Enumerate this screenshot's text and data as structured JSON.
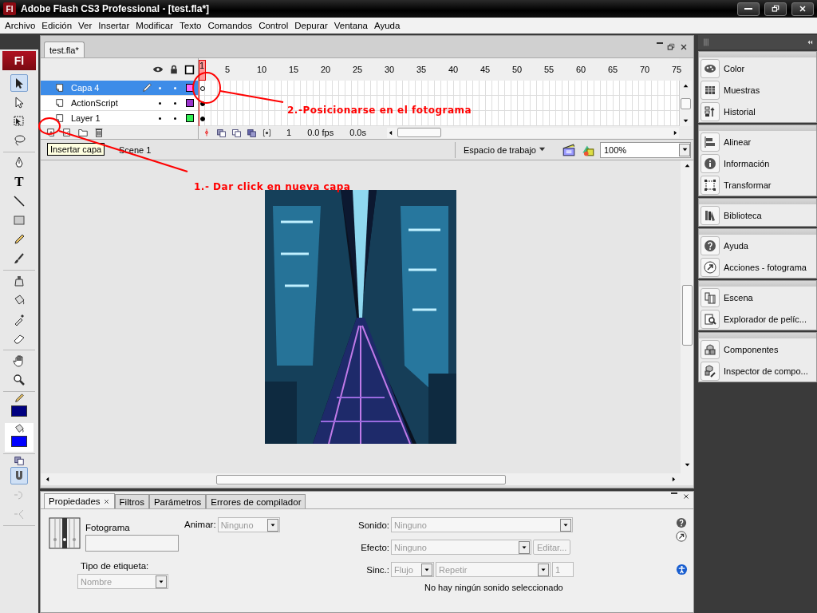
{
  "window": {
    "title": "Adobe Flash CS3 Professional - [test.fla*]",
    "badge": "Fl"
  },
  "menu": [
    "Archivo",
    "Edición",
    "Ver",
    "Insertar",
    "Modificar",
    "Texto",
    "Comandos",
    "Control",
    "Depurar",
    "Ventana",
    "Ayuda"
  ],
  "tools": {
    "logo": "Fl",
    "groups": [
      [
        {
          "kind": "selection",
          "selected": true
        },
        {
          "kind": "subselection",
          "selected": false
        },
        {
          "kind": "free-transform",
          "selected": false
        },
        {
          "kind": "lasso",
          "selected": false
        }
      ],
      [
        {
          "kind": "pen",
          "selected": false
        },
        {
          "kind": "text",
          "label": "T",
          "selected": false
        },
        {
          "kind": "line",
          "selected": false
        },
        {
          "kind": "rectangle",
          "selected": false
        },
        {
          "kind": "pencil",
          "selected": false
        },
        {
          "kind": "brush",
          "selected": false
        }
      ],
      [
        {
          "kind": "ink-bottle",
          "selected": false
        },
        {
          "kind": "paint-bucket",
          "selected": false
        },
        {
          "kind": "eyedropper",
          "selected": false
        },
        {
          "kind": "eraser",
          "selected": false
        }
      ],
      [
        {
          "kind": "hand",
          "selected": false
        },
        {
          "kind": "zoom",
          "selected": false
        }
      ]
    ],
    "stroke": {
      "color": "#000080"
    },
    "fill": {
      "color": "#0000ff"
    },
    "snap": {
      "on": true
    },
    "options": [
      {
        "kind": "smooth",
        "disabled": true
      },
      {
        "kind": "straighten",
        "disabled": true
      }
    ]
  },
  "document": {
    "tab": "test.fla*",
    "timeline": {
      "current_frame": "1",
      "frame_numbers": [
        "5",
        "10",
        "15",
        "20",
        "25",
        "30",
        "35",
        "40",
        "45",
        "50",
        "55",
        "60",
        "65",
        "70",
        "75"
      ],
      "layers": [
        {
          "name": "Capa 4",
          "selected": true,
          "color": "#ff66ff",
          "filled_keyframe": false
        },
        {
          "name": "ActionScript",
          "selected": false,
          "color": "#9933cc",
          "filled_keyframe": true
        },
        {
          "name": "Layer 1",
          "selected": false,
          "color": "#33ee55",
          "filled_keyframe": true
        }
      ],
      "footer": {
        "frame": "1",
        "fps": "0.0 fps",
        "time": "0.0s"
      }
    },
    "edit_bar": {
      "tooltip": "Insertar capa",
      "scene": "Scene 1",
      "workspace": "Espacio de trabajo",
      "zoom": "100%"
    }
  },
  "annotations": [
    {
      "text": "2.-Posicionarse en el fotograma"
    },
    {
      "text": "1.- Dar click en nueva capa"
    }
  ],
  "properties": {
    "tabs": [
      {
        "label": "Propiedades",
        "selected": true
      },
      {
        "label": "Filtros",
        "selected": false
      },
      {
        "label": "Parámetros",
        "selected": false
      },
      {
        "label": "Errores de compilador",
        "selected": false
      }
    ],
    "frame": {
      "label": "Fotograma"
    },
    "label_type": {
      "label": "Tipo de etiqueta:",
      "value": "Nombre",
      "disabled": true
    },
    "tween": {
      "label": "Animar:",
      "value": "Ninguno",
      "disabled": true
    },
    "sound": {
      "label": "Sonido:",
      "value": "Ninguno",
      "disabled": true
    },
    "effect": {
      "label": "Efecto:",
      "value": "Ninguno",
      "disabled": true
    },
    "edit_button": {
      "label": "Editar...",
      "disabled": true
    },
    "sync": {
      "label": "Sinc.:",
      "value": "Flujo",
      "disabled": true
    },
    "repeat": {
      "value": "Repetir",
      "disabled": true
    },
    "repeat_count": {
      "value": "1",
      "disabled": true
    },
    "status": "No hay ningún sonido seleccionado"
  },
  "panels": [
    {
      "items": [
        {
          "label": "Color",
          "kind": "color"
        },
        {
          "label": "Muestras",
          "kind": "swatches"
        },
        {
          "label": "Historial",
          "kind": "history"
        }
      ]
    },
    {
      "items": [
        {
          "label": "Alinear",
          "kind": "align"
        },
        {
          "label": "Información",
          "kind": "info"
        },
        {
          "label": "Transformar",
          "kind": "transform"
        }
      ]
    },
    {
      "items": [
        {
          "label": "Biblioteca",
          "kind": "library"
        }
      ]
    },
    {
      "items": [
        {
          "label": "Ayuda",
          "kind": "help"
        },
        {
          "label": "Acciones - fotograma",
          "kind": "actions"
        }
      ]
    },
    {
      "items": [
        {
          "label": "Escena",
          "kind": "scene"
        },
        {
          "label": "Explorador de pelíc...",
          "kind": "explorer"
        }
      ]
    },
    {
      "items": [
        {
          "label": "Componentes",
          "kind": "components"
        },
        {
          "label": "Inspector de compo...",
          "kind": "inspector"
        }
      ]
    }
  ]
}
